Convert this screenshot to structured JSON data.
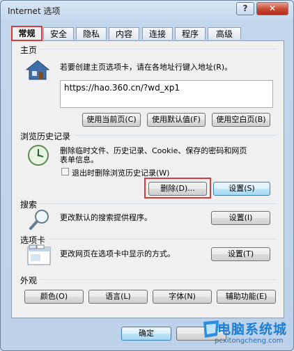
{
  "window": {
    "title": "Internet 选项",
    "help_label": "?",
    "close_label": "✕"
  },
  "tabs": [
    {
      "label": "常规",
      "active": true
    },
    {
      "label": "安全"
    },
    {
      "label": "隐私"
    },
    {
      "label": "内容"
    },
    {
      "label": "连接"
    },
    {
      "label": "程序"
    },
    {
      "label": "高级"
    }
  ],
  "homepage": {
    "group_label": "主页",
    "description": "若要创建主页选项卡，请在各地址行键入地址(R)。",
    "url": "https://hao.360.cn/?wd_xp1",
    "buttons": [
      "使用当前页(C)",
      "使用默认值(F)",
      "使用空白页(B)"
    ]
  },
  "history": {
    "group_label": "浏览历史记录",
    "description_line1": "删除临时文件、历史记录、Cookie、保存的密码和网页",
    "description_line2": "表单信息。",
    "checkbox_label": "退出时删除浏览历史记录(W)",
    "checkbox_checked": false,
    "delete_button": "删除(D)...",
    "settings_button": "设置(S)"
  },
  "search": {
    "group_label": "搜索",
    "description": "更改默认的搜索提供程序。",
    "settings_button": "设置(I)"
  },
  "tabs_section": {
    "group_label": "选项卡",
    "description": "更改网页在选项卡中显示的方式。",
    "settings_button": "设置(T)"
  },
  "appearance": {
    "group_label": "外观",
    "buttons": [
      "颜色(O)",
      "语言(L)",
      "字体(N)",
      "辅助功能(E)"
    ]
  },
  "footer": {
    "ok_button": "确定"
  },
  "watermark": {
    "title": "电脑系统城",
    "url": "pcxitongcheng.com"
  },
  "colors": {
    "highlight": "#d43d3d",
    "close_red": "#c7472f"
  }
}
